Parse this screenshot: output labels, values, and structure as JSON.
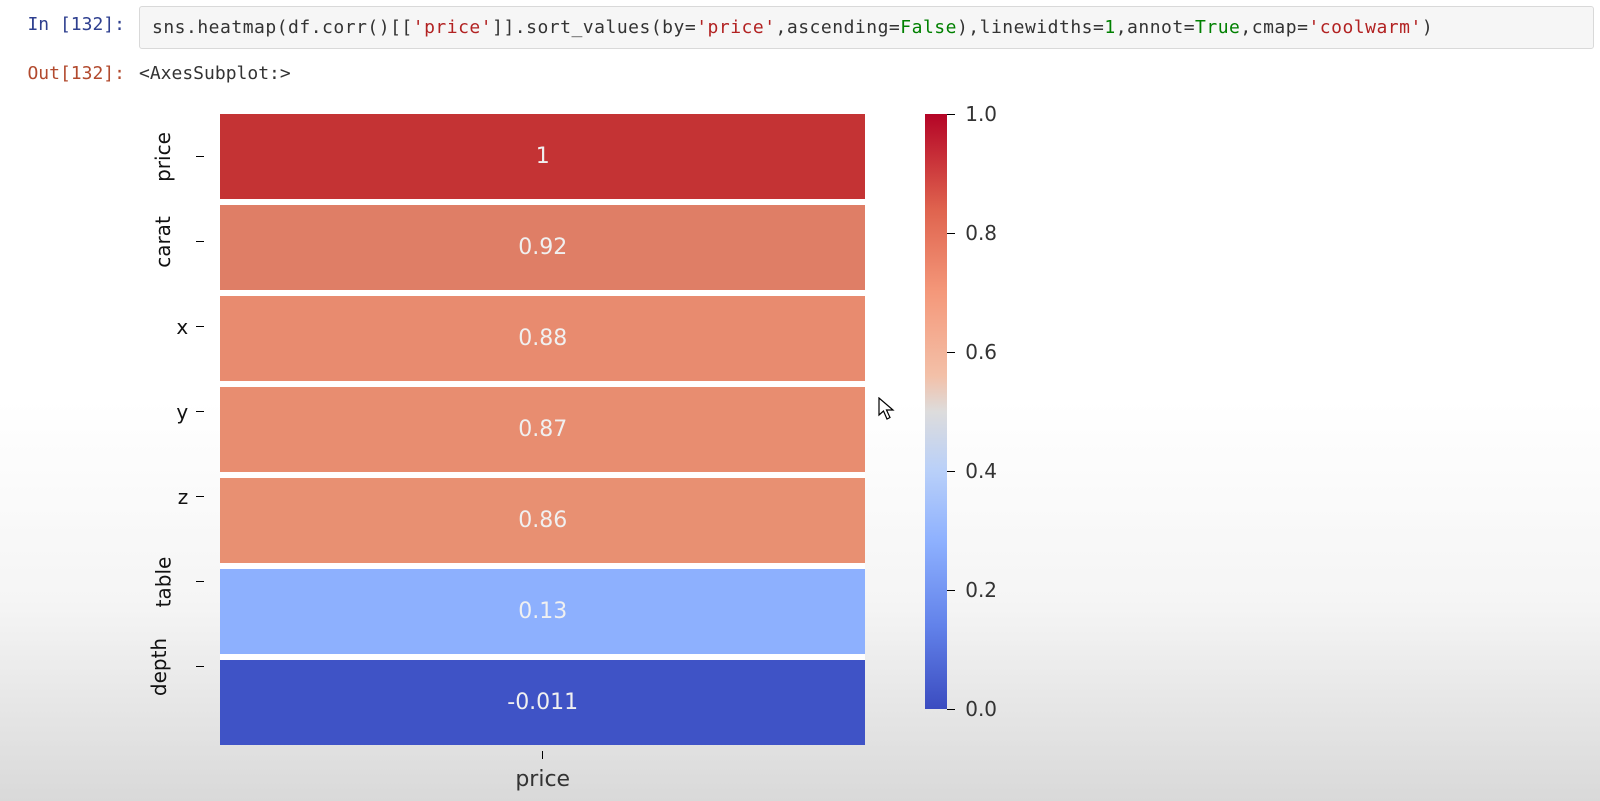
{
  "cell": {
    "in_prompt": "In [132]:",
    "out_prompt": "Out[132]:",
    "out_text": "<AxesSubplot:>",
    "code": {
      "t1": "sns.heatmap(df.corr()[[",
      "s1": "'price'",
      "t2": "]].sort_values(by=",
      "s2": "'price'",
      "t3": ",ascending=",
      "k1": "False",
      "t4": "),linewidths=",
      "n1": "1",
      "t5": ",annot=",
      "k2": "True",
      "t6": ",cmap=",
      "s3": "'coolwarm'",
      "t7": ")"
    }
  },
  "chart_data": {
    "type": "heatmap",
    "xlabel": "price",
    "ylabels": [
      "price",
      "carat",
      "x",
      "y",
      "z",
      "table",
      "depth"
    ],
    "values": [
      1,
      0.92,
      0.88,
      0.87,
      0.86,
      0.13,
      -0.011
    ],
    "annotations": [
      "1",
      "0.92",
      "0.88",
      "0.87",
      "0.86",
      "0.13",
      "-0.011"
    ],
    "colorbar_ticks": [
      {
        "value": "1.0",
        "pos": 0
      },
      {
        "value": "0.8",
        "pos": 0.2
      },
      {
        "value": "0.6",
        "pos": 0.4
      },
      {
        "value": "0.4",
        "pos": 0.6
      },
      {
        "value": "0.2",
        "pos": 0.8
      },
      {
        "value": "0.0",
        "pos": 1.0
      }
    ],
    "cmap": "coolwarm",
    "vmin": 0.0,
    "vmax": 1.0
  },
  "colors": {
    "rows": [
      "#c43334",
      "#df7e66",
      "#e88b6f",
      "#e88d70",
      "#e89072",
      "#8db0fe",
      "#3f53c6"
    ]
  }
}
